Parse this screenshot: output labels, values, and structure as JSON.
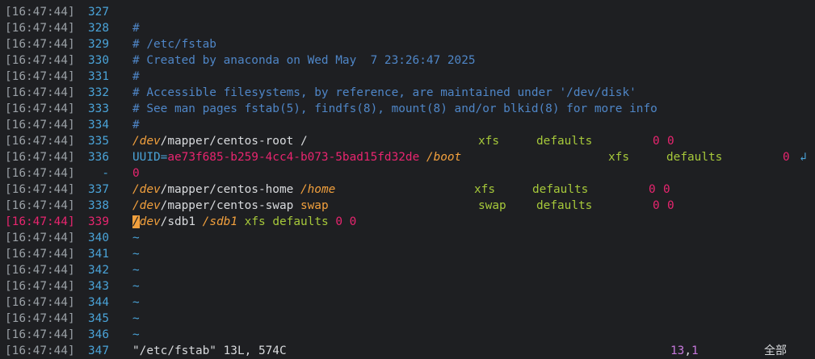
{
  "timestamp": "[16:47:44]",
  "lines": [
    {
      "ln": "327",
      "kind": "empty"
    },
    {
      "ln": "328",
      "kind": "comment",
      "text": "#"
    },
    {
      "ln": "329",
      "kind": "comment",
      "text": "# /etc/fstab"
    },
    {
      "ln": "330",
      "kind": "comment",
      "text": "# Created by anaconda on Wed May  7 23:26:47 2025"
    },
    {
      "ln": "331",
      "kind": "comment",
      "text": "#"
    },
    {
      "ln": "332",
      "kind": "comment",
      "text": "# Accessible filesystems, by reference, are maintained under '/dev/disk'"
    },
    {
      "ln": "333",
      "kind": "comment",
      "text": "# See man pages fstab(5), findfs(8), mount(8) and/or blkid(8) for more info"
    },
    {
      "ln": "334",
      "kind": "comment",
      "text": "#"
    },
    {
      "ln": "335",
      "kind": "entry",
      "dev": "/dev",
      "dev_rest": "/mapper/centos-root",
      "mount": "/",
      "mount_style": "plain",
      "fs": "xfs",
      "opts": "defaults",
      "dump": "0",
      "pass": "0",
      "cols": [
        592,
        664,
        808,
        826
      ]
    },
    {
      "ln": "336",
      "kind": "uuid",
      "uuid_key": "UUID=",
      "uuid_val": "ae73f685-b259-4cc4-b073-5bad15fd32de",
      "mount": "/boot",
      "fs": "xfs",
      "opts": "defaults",
      "dump": "0",
      "wrap": "↲",
      "cols": [
        753,
        825,
        969
      ]
    },
    {
      "ln": "-",
      "kind": "wrapped",
      "text": "0"
    },
    {
      "ln": "337",
      "kind": "entry",
      "dev": "/dev",
      "dev_rest": "/mapper/centos-home",
      "mount": "/home",
      "mount_style": "italic",
      "fs": "xfs",
      "opts": "defaults",
      "dump": "0",
      "pass": "0",
      "cols": [
        587,
        659,
        803,
        821
      ]
    },
    {
      "ln": "338",
      "kind": "entry",
      "dev": "/dev",
      "dev_rest": "/mapper/centos-swap",
      "mount": "swap",
      "mount_style": "swap",
      "fs": "swap",
      "opts": "defaults",
      "dump": "0",
      "pass": "0",
      "cols": [
        592,
        664,
        808,
        826
      ]
    },
    {
      "ln": "339",
      "kind": "current",
      "cursor": "/",
      "dev_rest": "dev",
      "dev_path": "/sdb1",
      "mount": "/sdb1",
      "fs": "xfs",
      "opts": "defaults",
      "dump": "0",
      "pass": "0"
    },
    {
      "ln": "340",
      "kind": "tilde",
      "text": "~"
    },
    {
      "ln": "341",
      "kind": "tilde",
      "text": "~"
    },
    {
      "ln": "342",
      "kind": "tilde",
      "text": "~"
    },
    {
      "ln": "343",
      "kind": "tilde",
      "text": "~"
    },
    {
      "ln": "344",
      "kind": "tilde",
      "text": "~"
    },
    {
      "ln": "345",
      "kind": "tilde",
      "text": "~"
    },
    {
      "ln": "346",
      "kind": "tilde",
      "text": "~"
    },
    {
      "ln": "347",
      "kind": "status"
    }
  ],
  "status": {
    "file": "\"/etc/fstab\" 13L, 574C",
    "line": "13",
    "col": "1",
    "position": "全部"
  },
  "colors": {
    "background": "#1e1f22",
    "timestamp": "#9aa0a6",
    "line_number": "#4aa3d8",
    "current_line": "#e8256f",
    "comment": "#4f86c7",
    "accent_orange": "#f2a03d",
    "accent_green": "#a6c83a"
  }
}
